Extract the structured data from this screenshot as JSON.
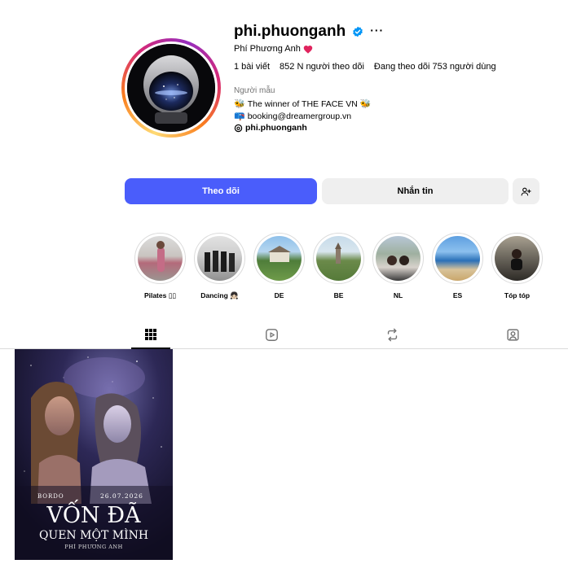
{
  "profile": {
    "username": "phi.phuonganh",
    "full_name": "Phí Phương Anh",
    "more_label": "···",
    "stats": {
      "posts": "1 bài viết",
      "followers": "852 N người theo dõi",
      "following": "Đang theo dõi 753 người dùng"
    },
    "category": "Người mẫu",
    "bio": {
      "line1": "The winner of THE FACE VN",
      "line2": "booking@dreamergroup.vn",
      "threads": "phi.phuonganh"
    }
  },
  "actions": {
    "follow": "Theo dõi",
    "message": "Nhắn tin"
  },
  "highlights": [
    {
      "label": "Pilates ▯▯"
    },
    {
      "label": "Dancing 👧🏻"
    },
    {
      "label": "DE"
    },
    {
      "label": "BE"
    },
    {
      "label": "NL"
    },
    {
      "label": "ES"
    },
    {
      "label": "Tóp tóp"
    }
  ],
  "post": {
    "left_tag": "BORDO",
    "date": "26.07.2026",
    "title1": "VỐN ĐÃ",
    "title2": "QUEN MỘT MÌNH",
    "artist": "PHÍ PHƯƠNG ANH"
  },
  "colors": {
    "follow_button": "#4a5dfb",
    "secondary_button": "#efefef",
    "verified": "#0095f6",
    "heart": "#e0245e"
  },
  "icons": [
    "verified-icon",
    "heart-icon",
    "add-person-icon",
    "grid-icon",
    "reels-icon",
    "reposts-icon",
    "tagged-icon",
    "threads-icon"
  ]
}
